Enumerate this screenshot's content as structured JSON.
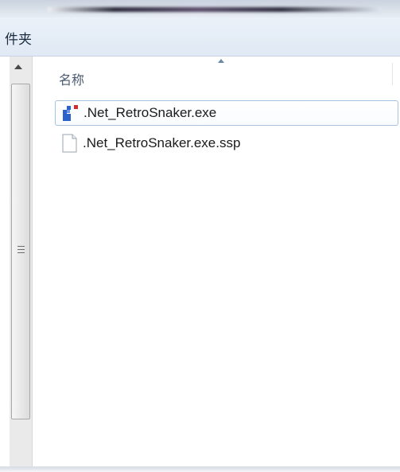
{
  "toolbar": {
    "label": "件夹"
  },
  "header": {
    "name_column": "名称"
  },
  "files": [
    {
      "name": ".Net_RetroSnaker.exe",
      "icon": "exe-app-icon",
      "selected": true
    },
    {
      "name": ".Net_RetroSnaker.exe.ssp",
      "icon": "blank-file-icon",
      "selected": false
    }
  ],
  "colors": {
    "toolbar_bg": "#e3ebf5",
    "selection_border": "#a9c2de",
    "text": "#1a1a1a"
  }
}
